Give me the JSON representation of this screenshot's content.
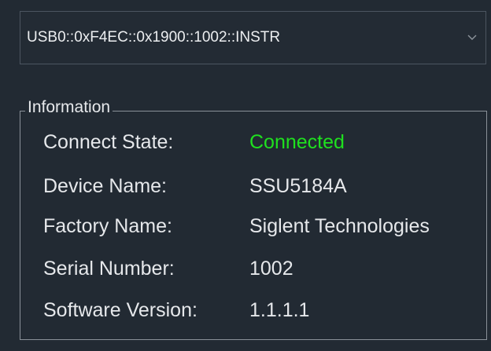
{
  "device_select": {
    "value": "USB0::0xF4EC::0x1900::1002::INSTR",
    "icon": "chevron-down-icon"
  },
  "info_group": {
    "title": "Information",
    "rows": [
      {
        "label": "Connect State:",
        "value": "Connected"
      },
      {
        "label": "Device Name:",
        "value": "SSU5184A"
      },
      {
        "label": "Factory Name:",
        "value": "Siglent Technologies"
      },
      {
        "label": "Serial Number:",
        "value": "1002"
      },
      {
        "label": "Software Version:",
        "value": "1.1.1.1"
      }
    ]
  },
  "colors": {
    "background": "#222a33",
    "text": "#e6e8eb",
    "connected": "#1fe01f",
    "border": "#8a9199"
  }
}
